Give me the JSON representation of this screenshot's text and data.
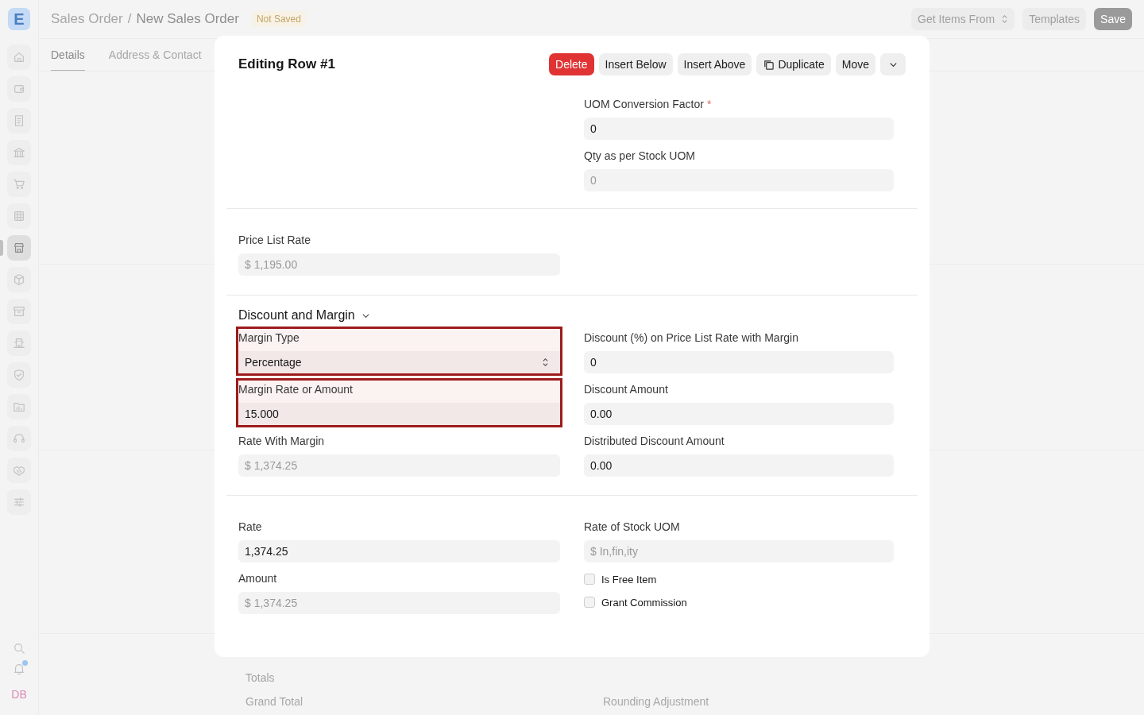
{
  "app": {
    "logo": "E",
    "breadcrumb": [
      {
        "label": "Sales Order"
      },
      {
        "label": "New Sales Order"
      }
    ],
    "separator": "/",
    "status": "Not Saved",
    "actions": [
      {
        "label": "Get Items From",
        "kind": "select"
      },
      {
        "label": "Templates",
        "kind": "plain"
      },
      {
        "label": "Save",
        "kind": "primary"
      }
    ]
  },
  "sidebar": {
    "items": [
      {
        "selected": false
      },
      {
        "selected": false
      },
      {
        "selected": false
      },
      {
        "selected": false
      },
      {
        "selected": false
      },
      {
        "selected": false
      },
      {
        "selected": true
      },
      {
        "selected": false
      },
      {
        "selected": false
      },
      {
        "selected": false
      },
      {
        "selected": false
      },
      {
        "selected": false
      },
      {
        "selected": false
      },
      {
        "selected": false
      },
      {
        "selected": false
      }
    ],
    "unread_notifications": true,
    "user_initials": "DB"
  },
  "tabs": [
    {
      "label": "Details",
      "selected": true
    },
    {
      "label": "Address & Contact",
      "selected": false
    }
  ],
  "background": {
    "section_title": "Totals",
    "fields": [
      "Grand Total",
      "Rounding Adjustment"
    ]
  },
  "dialog": {
    "title": "Editing Row #1",
    "required_mark": "*",
    "buttons": [
      {
        "label": "Delete",
        "kind": "danger"
      },
      {
        "label": "Insert Below",
        "kind": "plain"
      },
      {
        "label": "Insert Above",
        "kind": "plain"
      },
      {
        "label": "Duplicate",
        "kind": "copy"
      },
      {
        "label": "Move",
        "kind": "plain"
      },
      {
        "kind": "more"
      }
    ],
    "sections": [
      {
        "columns": [
          [],
          [
            {
              "kind": "input",
              "label": "UOM Conversion Factor",
              "value": "0",
              "required": true,
              "readonly": false,
              "highlighted": false
            },
            {
              "kind": "input",
              "label": "Qty as per Stock UOM",
              "value": "0",
              "required": false,
              "readonly": true,
              "highlighted": false
            }
          ]
        ]
      },
      {
        "columns": [
          [
            {
              "kind": "input",
              "label": "Price List Rate",
              "value": "$ 1,195.00",
              "required": false,
              "readonly": true,
              "highlighted": false
            }
          ],
          []
        ]
      },
      {
        "heading": "Discount and Margin",
        "expanded": true,
        "columns": [
          [
            {
              "kind": "select",
              "label": "Margin Type",
              "value": "Percentage",
              "required": false,
              "readonly": false,
              "highlighted": true
            },
            {
              "kind": "input",
              "label": "Margin Rate or Amount",
              "value": "15.000",
              "required": false,
              "readonly": false,
              "highlighted": true
            },
            {
              "kind": "input",
              "label": "Rate With Margin",
              "value": "$ 1,374.25",
              "required": false,
              "readonly": true,
              "highlighted": false
            }
          ],
          [
            {
              "kind": "input",
              "label": "Discount (%) on Price List Rate with Margin",
              "value": "0",
              "required": false,
              "readonly": false,
              "highlighted": false
            },
            {
              "kind": "input",
              "label": "Discount Amount",
              "value": "0.00",
              "required": false,
              "readonly": false,
              "highlighted": false
            },
            {
              "kind": "input",
              "label": "Distributed Discount Amount",
              "value": "0.00",
              "required": false,
              "readonly": false,
              "highlighted": false
            }
          ]
        ]
      },
      {
        "columns": [
          [
            {
              "kind": "input",
              "label": "Rate",
              "value": "1,374.25",
              "required": false,
              "readonly": false,
              "highlighted": false
            },
            {
              "kind": "input",
              "label": "Amount",
              "value": "$ 1,374.25",
              "required": false,
              "readonly": true,
              "highlighted": false
            }
          ],
          [
            {
              "kind": "input",
              "label": "Rate of Stock UOM",
              "value": "$ In,fin,ity",
              "required": false,
              "readonly": true,
              "highlighted": false
            },
            {
              "kind": "checkbox",
              "label": "Is Free Item",
              "checked": false
            },
            {
              "kind": "checkbox",
              "label": "Grant Commission",
              "checked": false
            }
          ]
        ]
      }
    ]
  }
}
